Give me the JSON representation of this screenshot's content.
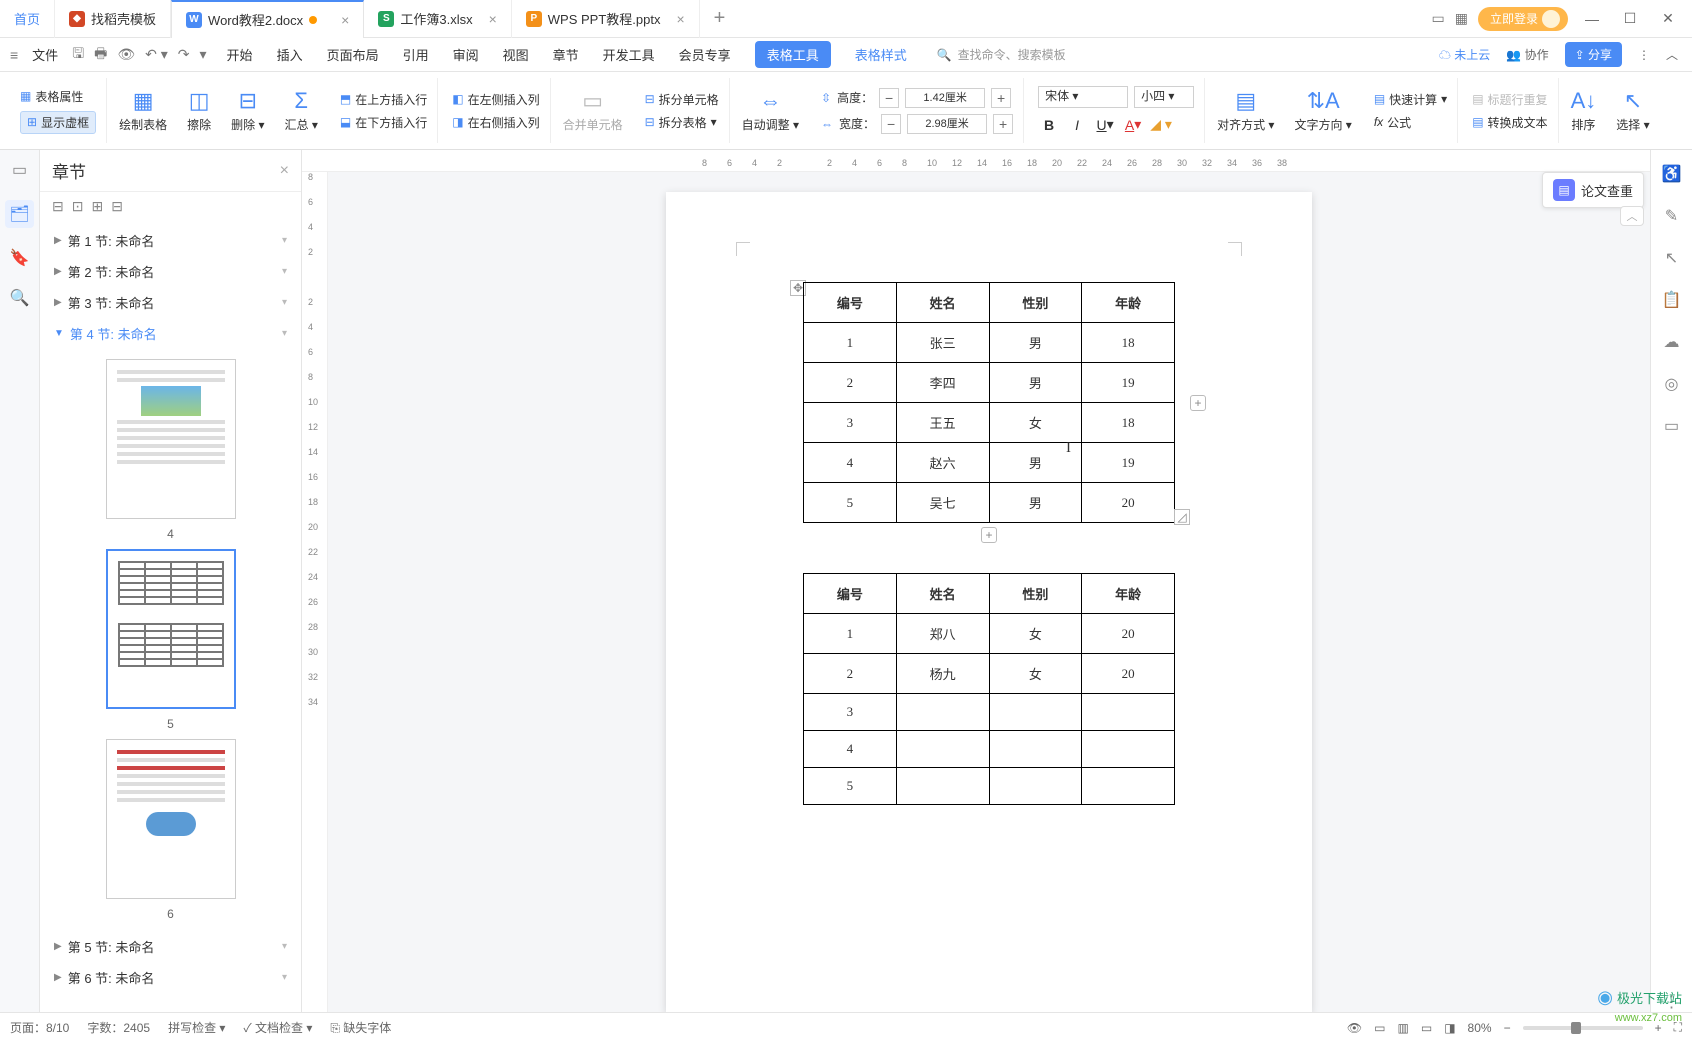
{
  "tabs": {
    "home": "首页",
    "template": "找稻壳模板",
    "doc": "Word教程2.docx",
    "xls": "工作簿3.xlsx",
    "ppt": "WPS PPT教程.pptx"
  },
  "titlebar": {
    "login": "立即登录"
  },
  "menubar": {
    "file": "文件",
    "items": [
      "开始",
      "插入",
      "页面布局",
      "引用",
      "审阅",
      "视图",
      "章节",
      "开发工具",
      "会员专享"
    ],
    "table_tools": "表格工具",
    "table_style": "表格样式",
    "search_placeholder": "查找命令、搜索模板",
    "cloud": "未上云",
    "coop": "协作",
    "share": "分享"
  },
  "ribbon": {
    "table_props": "表格属性",
    "show_dashed": "显示虚框",
    "draw_table": "绘制表格",
    "erase": "擦除",
    "delete": "删除",
    "summary": "汇总",
    "ins_above": "在上方插入行",
    "ins_below": "在下方插入行",
    "ins_left": "在左侧插入列",
    "ins_right": "在右侧插入列",
    "merge_cells": "合并单元格",
    "split_cells": "拆分单元格",
    "split_table": "拆分表格",
    "auto_fit": "自动调整",
    "height_label": "高度：",
    "height_val": "1.42厘米",
    "width_label": "宽度：",
    "width_val": "2.98厘米",
    "font_name": "宋体",
    "font_size": "小四",
    "align": "对齐方式",
    "text_dir": "文字方向",
    "fast_calc": "快速计算",
    "formula": "公式",
    "title_repeat": "标题行重复",
    "to_text": "转换成文本",
    "sort": "排序",
    "select": "选择"
  },
  "sidepanel": {
    "title": "章节",
    "sections": [
      {
        "label": "第 1 节: 未命名"
      },
      {
        "label": "第 2 节: 未命名"
      },
      {
        "label": "第 3 节: 未命名"
      },
      {
        "label": "第 4 节: 未命名"
      },
      {
        "label": "第 5 节: 未命名"
      },
      {
        "label": "第 6 节: 未命名"
      }
    ],
    "thumb_labels": [
      "4",
      "5",
      "6"
    ]
  },
  "ruler_h": [
    "8",
    "6",
    "4",
    "2",
    "",
    "2",
    "4",
    "6",
    "8",
    "10",
    "12",
    "14",
    "16",
    "18",
    "20",
    "22",
    "24",
    "26",
    "28",
    "30",
    "32",
    "34",
    "36",
    "38"
  ],
  "ruler_v": [
    "8",
    "6",
    "4",
    "2",
    "",
    "2",
    "4",
    "6",
    "8",
    "10",
    "12",
    "14",
    "16",
    "18",
    "20",
    "22",
    "24",
    "26",
    "28",
    "30",
    "32",
    "34"
  ],
  "table1": {
    "headers": [
      "编号",
      "姓名",
      "性别",
      "年龄"
    ],
    "rows": [
      [
        "1",
        "张三",
        "男",
        "18"
      ],
      [
        "2",
        "李四",
        "男",
        "19"
      ],
      [
        "3",
        "王五",
        "女",
        "18"
      ],
      [
        "4",
        "赵六",
        "男",
        "19"
      ],
      [
        "5",
        "吴七",
        "男",
        "20"
      ]
    ]
  },
  "table2": {
    "headers": [
      "编号",
      "姓名",
      "性别",
      "年龄"
    ],
    "rows": [
      [
        "1",
        "郑八",
        "女",
        "20"
      ],
      [
        "2",
        "杨九",
        "女",
        "20"
      ],
      [
        "3",
        "",
        "",
        ""
      ],
      [
        "4",
        "",
        "",
        ""
      ],
      [
        "5",
        "",
        "",
        ""
      ]
    ]
  },
  "float_btn": "论文查重",
  "statusbar": {
    "page": "页面：8/10",
    "words": "字数：2405",
    "spell": "拼写检查",
    "doc_check": "文档检查",
    "missing_font": "缺失字体",
    "zoom": "80%"
  },
  "watermark": {
    "main": "极光下载站",
    "sub": "www.xz7.com"
  }
}
